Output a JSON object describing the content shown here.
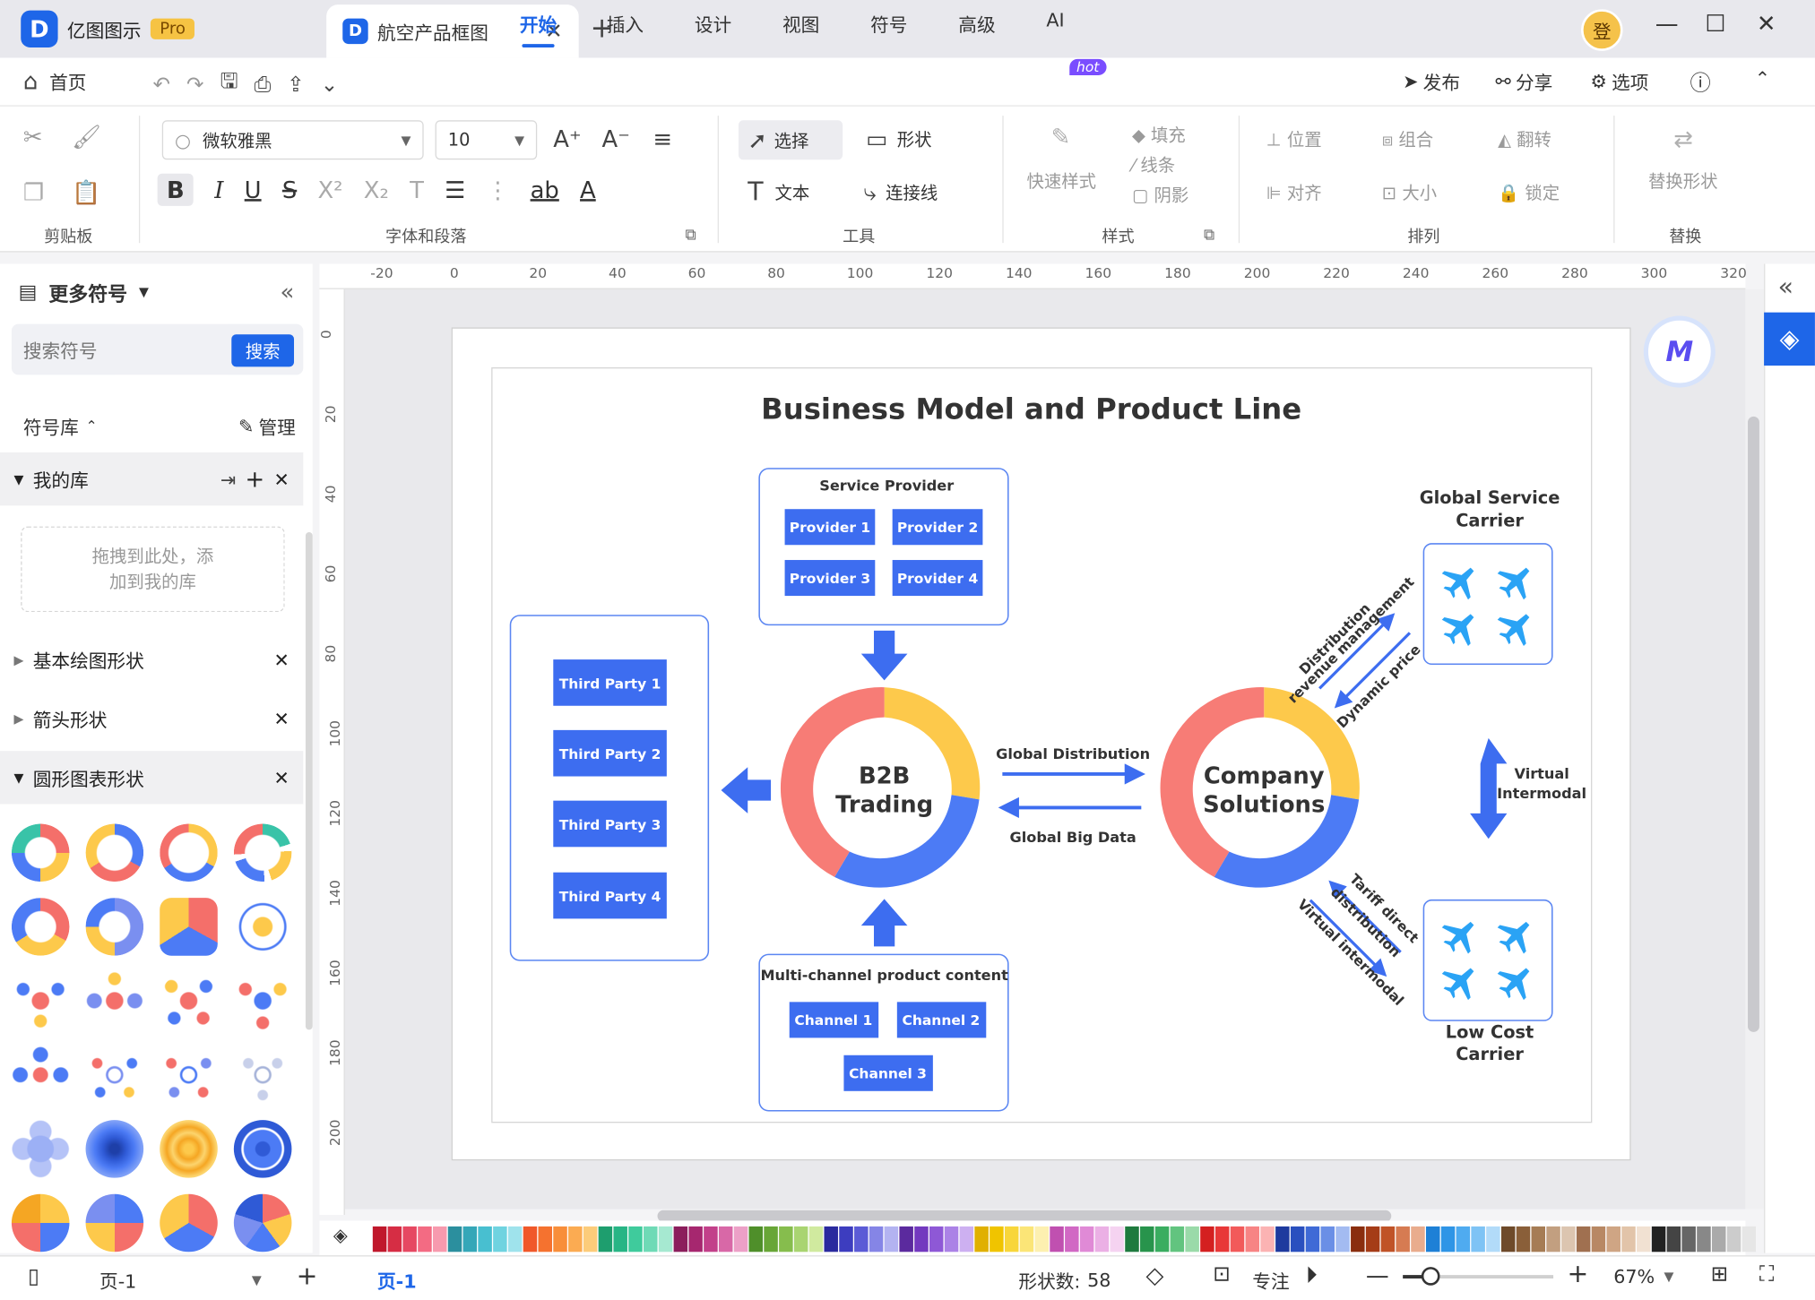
{
  "titlebar": {
    "app_name": "亿图图示",
    "pro_badge": "Pro",
    "doc_tab": "航空产品框图",
    "user_initial": "登"
  },
  "menubar": {
    "home": "首页",
    "tabs": [
      "开始",
      "插入",
      "设计",
      "视图",
      "符号",
      "高级",
      "AI"
    ],
    "active_tab": "开始",
    "ai_badge": "hot",
    "publish": "发布",
    "share": "分享",
    "options": "选项"
  },
  "ribbon": {
    "clipboard_label": "剪贴板",
    "font_name": "微软雅黑",
    "font_size": "10",
    "font_label": "字体和段落",
    "select": "选择",
    "shape": "形状",
    "text": "文本",
    "connector": "连接线",
    "tools_label": "工具",
    "quick_style": "快速样式",
    "fill": "填充",
    "line": "线条",
    "shadow": "阴影",
    "style_label": "样式",
    "position": "位置",
    "group": "组合",
    "flip": "翻转",
    "align": "对齐",
    "size": "大小",
    "lock": "锁定",
    "arrange_label": "排列",
    "replace_shape": "替换形状",
    "replace_label": "替换"
  },
  "sidebar": {
    "title": "更多符号",
    "search_placeholder": "搜索符号",
    "search_button": "搜索",
    "library_label": "符号库",
    "manage": "管理",
    "my_library": "我的库",
    "drop_hint_1": "拖拽到此处，添",
    "drop_hint_2": "加到我的库",
    "groups": [
      "基本绘图形状",
      "箭头形状",
      "圆形图表形状"
    ]
  },
  "ruler": {
    "h_ticks": [
      "-20",
      "0",
      "20",
      "40",
      "60",
      "80",
      "100",
      "120",
      "140",
      "160",
      "180",
      "200",
      "220",
      "240",
      "260",
      "280",
      "300",
      "320"
    ],
    "v_ticks": [
      "0",
      "20",
      "40",
      "60",
      "80",
      "100",
      "120",
      "140",
      "160",
      "180",
      "200"
    ]
  },
  "diagram": {
    "title": "Business Model and Product Line",
    "service_provider": {
      "title": "Service Provider",
      "items": [
        "Provider 1",
        "Provider 2",
        "Provider 3",
        "Provider 4"
      ]
    },
    "third_parties": [
      "Third Party 1",
      "Third Party 2",
      "Third Party 3",
      "Third Party 4"
    ],
    "b2b_line1": "B2B",
    "b2b_line2": "Trading",
    "company_line1": "Company",
    "company_line2": "Solutions",
    "global_distribution": "Global Distribution",
    "global_big_data": "Global Big Data",
    "multichannel": {
      "title": "Multi-channel product content",
      "items": [
        "Channel 1",
        "Channel 2",
        "Channel 3"
      ]
    },
    "global_service_carrier_1": "Global Service",
    "global_service_carrier_2": "Carrier",
    "low_cost_carrier_1": "Low Cost",
    "low_cost_carrier_2": "Carrier",
    "distribution": "Distribution",
    "revenue_management": "revenue management",
    "dynamic_price": "Dynamic price",
    "virtual_1": "Virtual",
    "virtual_2": "Intermodal",
    "tariff_direct": "Tariff direct",
    "tariff_distribution": "distribution",
    "virtual_intermodal": "Virtual intermodal"
  },
  "status": {
    "page_name": "页-1",
    "active_page": "页-1",
    "shape_count_label": "形状数:",
    "shape_count": "58",
    "focus": "专注",
    "zoom": "67%"
  },
  "colors": {
    "accent": "#1e66e8",
    "ring_yellow": "#fdc94b",
    "ring_red": "#f77c76",
    "ring_blue": "#4c7bf5",
    "box_blue": "#3d6df0"
  },
  "palette": [
    "#c0182c",
    "#d62d44",
    "#e64862",
    "#f36b83",
    "#f79aae",
    "#2b8f9e",
    "#35a7b8",
    "#48bfd0",
    "#6fd3e0",
    "#9fe3ec",
    "#f0582a",
    "#f5722f",
    "#f88e3a",
    "#fbab52",
    "#fccc7a",
    "#1e9e6e",
    "#27b585",
    "#3fcb9c",
    "#6fdab6",
    "#a6e9d1",
    "#8b1e5c",
    "#a6276f",
    "#c2408a",
    "#d868a7",
    "#eca0c7",
    "#4f8f2a",
    "#68a637",
    "#86bd4d",
    "#a9d471",
    "#d0ea9f",
    "#2a2a9e",
    "#3d3dbf",
    "#5b5bd6",
    "#8585e6",
    "#b3b3f1",
    "#5b2a9e",
    "#7339bf",
    "#8e58d6",
    "#ab82e6",
    "#cdb0f1",
    "#e0b000",
    "#f0c400",
    "#f8d63a",
    "#fbe577",
    "#fdf0b0",
    "#c050b0",
    "#d168c4",
    "#e08ad6",
    "#ebb0e5",
    "#f5d3f1",
    "#1e7a3e",
    "#28944c",
    "#3aad60",
    "#62c47f",
    "#9adaa9",
    "#d42020",
    "#e83838",
    "#f25a5a",
    "#f78484",
    "#fbb3b3",
    "#1e3a9e",
    "#2a50bf",
    "#3f6ad6",
    "#6a8fe6",
    "#a3bbf1",
    "#8a2e0e",
    "#a53c17",
    "#c05327",
    "#d67b52",
    "#e9ac8d",
    "#1e80d6",
    "#2f95e6",
    "#4fabf0",
    "#7ec3f5",
    "#b2dbf9",
    "#6e4a2a",
    "#8a5f39",
    "#a67c55",
    "#c29f80",
    "#dcc5b0",
    "#a07050",
    "#b88864",
    "#cfa584",
    "#e2c4a9",
    "#f1e1d2",
    "#222222",
    "#444444",
    "#666666",
    "#888888",
    "#aaaaaa",
    "#cccccc",
    "#e6e6e6"
  ]
}
